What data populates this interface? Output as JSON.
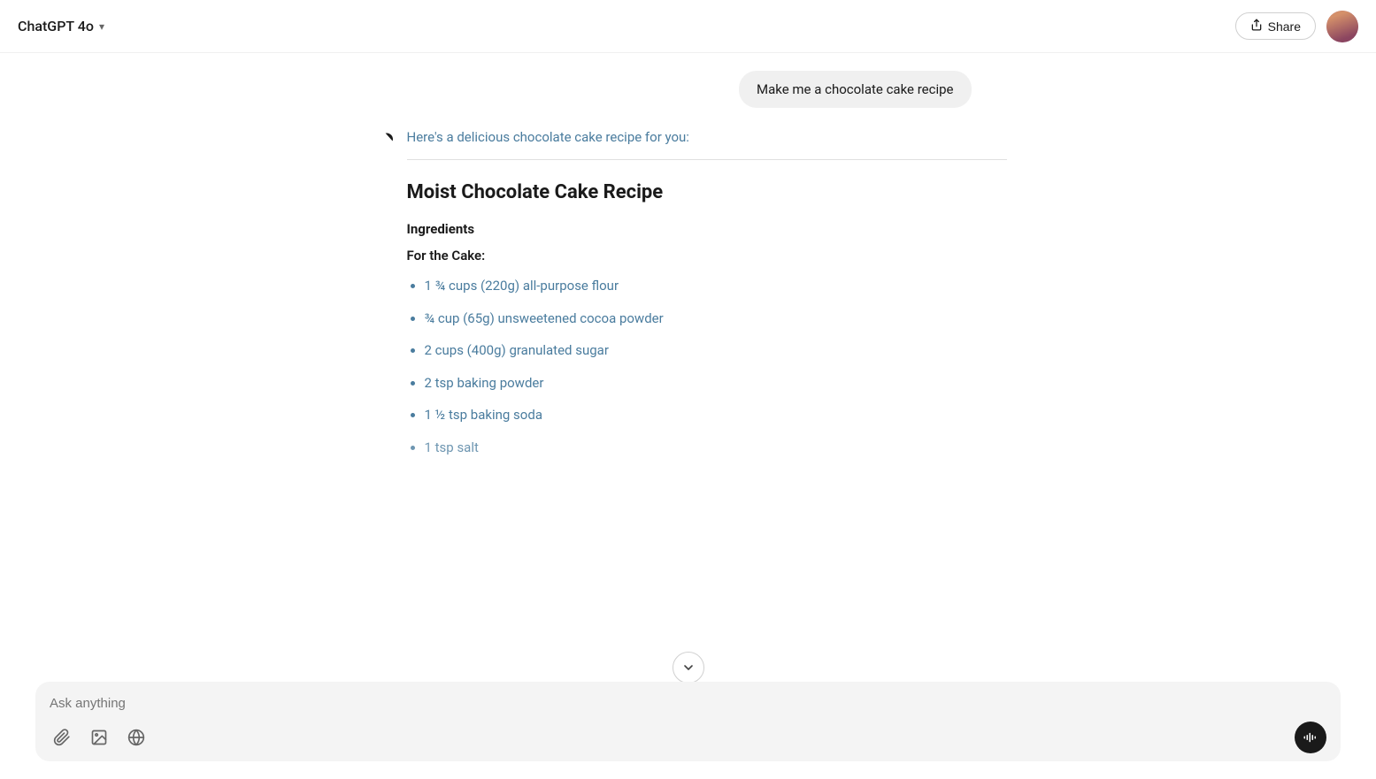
{
  "header": {
    "title": "ChatGPT 4o",
    "chevron": "▾",
    "share_label": "Share",
    "share_icon": "⬆"
  },
  "user_message": {
    "text": "Make me a chocolate cake recipe"
  },
  "ai_response": {
    "intro": "Here's a delicious chocolate cake recipe for you:",
    "recipe_title": "Moist Chocolate Cake Recipe",
    "sections": [
      {
        "heading": "Ingredients",
        "sub_sections": [
          {
            "sub_heading": "For the Cake:",
            "items": [
              "1 ¾ cups (220g) all-purpose flour",
              "¾ cup (65g) unsweetened cocoa powder",
              "2 cups (400g) granulated sugar",
              "2 tsp baking powder",
              "1 ½ tsp baking soda",
              "1 tsp salt"
            ]
          }
        ]
      }
    ]
  },
  "input": {
    "placeholder": "Ask anything"
  },
  "toolbar": {
    "attach_label": "Attach",
    "image_label": "Image",
    "browse_label": "Browse"
  }
}
